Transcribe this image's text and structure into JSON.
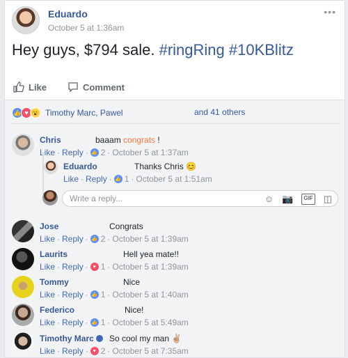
{
  "post": {
    "author": "Eduardo",
    "time": "October 5 at 1:36am",
    "more": "•••",
    "text_plain": "Hey guys, $794 sale. ",
    "tag1": "#ringRing",
    "tag2": "#10KBlitz"
  },
  "actions": {
    "like": "Like",
    "comment": "Comment"
  },
  "reactions": {
    "names": "Timothy Marc, Pawel",
    "others": "and 41 others"
  },
  "meta": {
    "like": "Like",
    "reply": "Reply"
  },
  "comments": [
    {
      "name": "Chris",
      "text_pre": "baaam ",
      "text_hl": "congrats",
      "text_post": " !",
      "count": "2",
      "time": "October 5 at 1:37am"
    },
    {
      "name": "Eduardo",
      "text": "Thanks Chris 😊",
      "count": "1",
      "time": "October 5 at 1:51am"
    },
    {
      "name": "Jose",
      "text": "Congrats",
      "count": "2",
      "time": "October 5 at 1:39am"
    },
    {
      "name": "Laurits",
      "text": "Hell yea mate!!",
      "count": "1",
      "time": "October 5 at 1:39am"
    },
    {
      "name": "Tommy",
      "text": "Nice",
      "count": "1",
      "time": "October 5 at 1:40am"
    },
    {
      "name": "Federico",
      "text": "Nice!",
      "count": "1",
      "time": "October 5 at 5:49am"
    },
    {
      "name": "Timothy Marc",
      "text": "So cool my man ✌🏼",
      "count": "2",
      "time": "October 5 at 7:35am"
    }
  ],
  "write_reply": {
    "placeholder": "Write a reply..."
  },
  "colors": {
    "link": "#365899",
    "accent": "#4267b2",
    "like": "#5890ff",
    "love": "#f25268",
    "highlight": "#f7773a"
  }
}
